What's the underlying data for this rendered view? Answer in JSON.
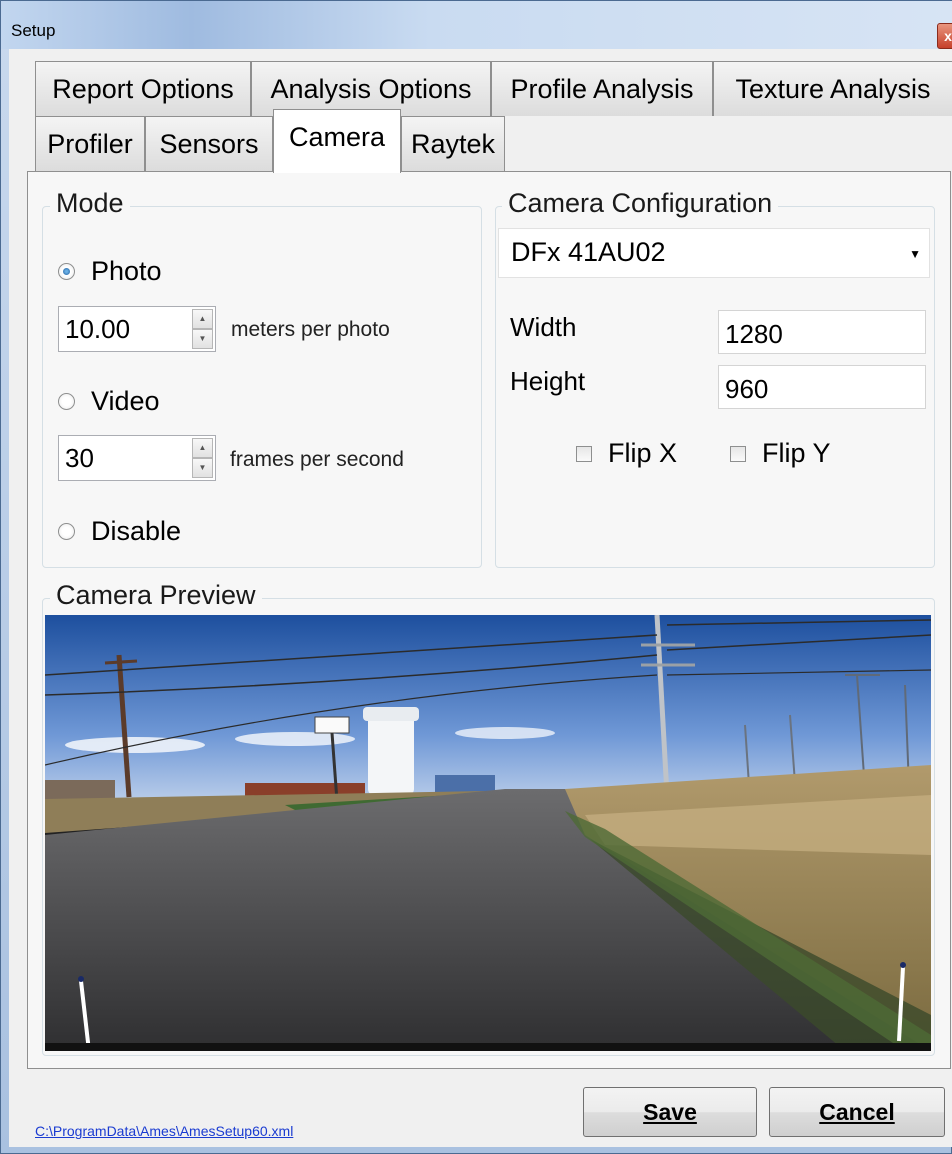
{
  "window": {
    "title": "Setup",
    "close_symbol": "x"
  },
  "tabs_row1": [
    {
      "label": "Report Options"
    },
    {
      "label": "Analysis Options"
    },
    {
      "label": "Profile Analysis"
    },
    {
      "label": "Texture Analysis"
    }
  ],
  "tabs_row2": [
    {
      "label": "Profiler"
    },
    {
      "label": "Sensors"
    },
    {
      "label": "Camera",
      "active": true
    },
    {
      "label": "Raytek"
    }
  ],
  "mode": {
    "title": "Mode",
    "photo_label": "Photo",
    "photo_value": "10.00",
    "photo_unit": "meters per photo",
    "video_label": "Video",
    "video_value": "30",
    "video_unit": "frames per second",
    "disable_label": "Disable",
    "selected": "Photo"
  },
  "config": {
    "title": "Camera Configuration",
    "camera_model": "DFx 41AU02",
    "width_label": "Width",
    "width_value": "1280",
    "height_label": "Height",
    "height_value": "960",
    "flip_x_label": "Flip X",
    "flip_y_label": "Flip Y",
    "flip_x_checked": false,
    "flip_y_checked": false
  },
  "preview": {
    "title": "Camera Preview"
  },
  "footer": {
    "config_path": "C:\\ProgramData\\Ames\\AmesSetup60.xml",
    "save_label": "Save",
    "cancel_label": "Cancel"
  },
  "colors": {
    "accent_selected_radio": "#1d5a9a",
    "link": "#1a3bd1",
    "close_button": "#c6402a"
  }
}
